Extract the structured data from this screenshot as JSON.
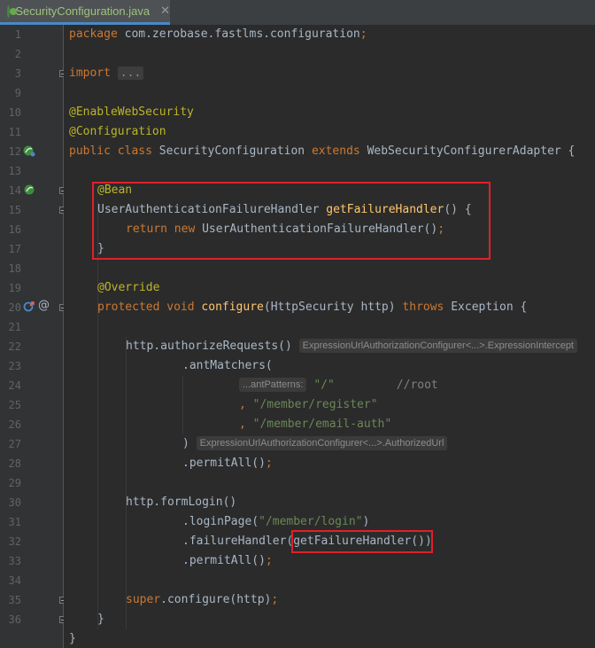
{
  "tab": {
    "file_name": "SecurityConfiguration.java",
    "close_label": "✕"
  },
  "lines": [
    {
      "num": "1"
    },
    {
      "num": "2"
    },
    {
      "num": "3"
    },
    {
      "num": "9"
    },
    {
      "num": "10"
    },
    {
      "num": "11"
    },
    {
      "num": "12"
    },
    {
      "num": "13"
    },
    {
      "num": "14"
    },
    {
      "num": "15"
    },
    {
      "num": "16"
    },
    {
      "num": "17"
    },
    {
      "num": "18"
    },
    {
      "num": "19"
    },
    {
      "num": "20"
    },
    {
      "num": "21"
    },
    {
      "num": "22"
    },
    {
      "num": "23"
    },
    {
      "num": "24"
    },
    {
      "num": "25"
    },
    {
      "num": "26"
    },
    {
      "num": "27"
    },
    {
      "num": "28"
    },
    {
      "num": "29"
    },
    {
      "num": "30"
    },
    {
      "num": "31"
    },
    {
      "num": "32"
    },
    {
      "num": "33"
    },
    {
      "num": "34"
    },
    {
      "num": "35"
    },
    {
      "num": "36"
    }
  ],
  "code": {
    "package_kw": "package",
    "package_name": " com.zerobase.fastlms.configuration",
    "semicolon": ";",
    "import_kw": "import",
    "import_fold": "...",
    "ann_websec": "@EnableWebSecurity",
    "ann_config": "@Configuration",
    "public_kw": "public",
    "class_kw": "class",
    "class_name": " SecurityConfiguration ",
    "extends_kw": "extends",
    "super_class": " WebSecurityConfigurerAdapter {",
    "ann_bean": "@Bean",
    "handler_type": "UserAuthenticationFailureHandler ",
    "get_handler": "getFailureHandler",
    "method_open": "() {",
    "return_kw": "return",
    "new_kw": "new",
    "new_handler": " UserAuthenticationFailureHandler()",
    "close_brace": "}",
    "ann_override": "@Override",
    "protected_kw": "protected",
    "void_kw": "void",
    "configure_fn": "configure",
    "configure_params": "(HttpSecurity http) ",
    "throws_kw": "throws",
    "exception_open": " Exception {",
    "authorize_requests": "http.authorizeRequests()",
    "hint_registry": "ExpressionUrlAuthorizationConfigurer<...>.ExpressionIntercept",
    "ant_matchers": ".antMatchers(",
    "hint_ant_patterns": "...antPatterns:",
    "str_root": "\"/\"",
    "cmt_root": "//root",
    "comma": ", ",
    "str_register": "\"/member/register\"",
    "str_email_auth": "\"/member/email-auth\"",
    "close_paren": ")",
    "hint_authorized": "ExpressionUrlAuthorizationConfigurer<...>.AuthorizedUrl",
    "permit_all": ".permitAll()",
    "form_login": "http.formLogin()",
    "login_page": ".loginPage(",
    "str_login": "\"/member/login\"",
    "failure_handler": ".failureHandler(",
    "get_handler_call": "getFailureHandler()",
    "super_kw": "super",
    "super_configure": ".configure(http)"
  },
  "colors": {
    "keyword": "#cc7832",
    "annotation": "#bbb529",
    "string": "#6a8759",
    "comment": "#808080",
    "method": "#ffc66d",
    "text": "#a9b7c6",
    "highlight_box": "#e0202a"
  }
}
